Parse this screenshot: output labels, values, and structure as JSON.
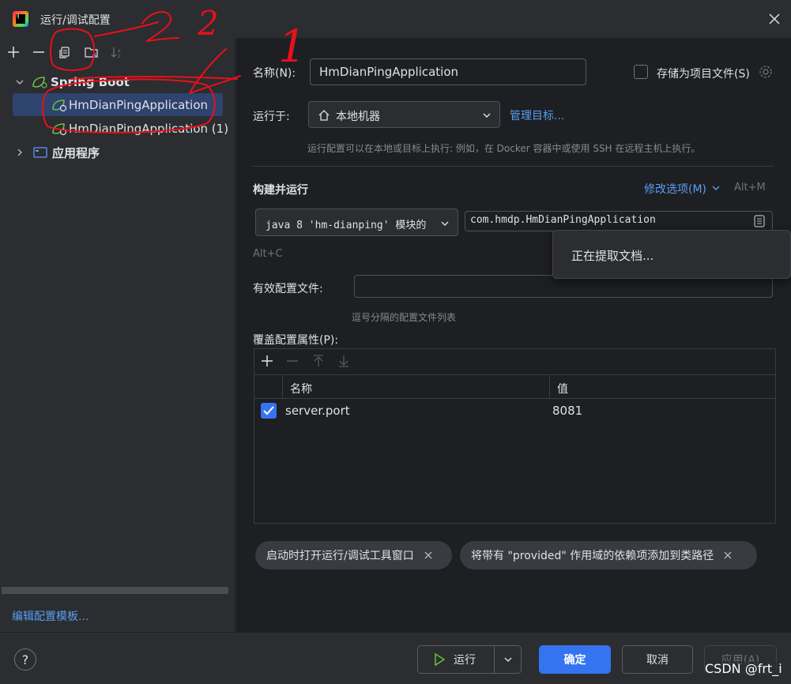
{
  "window": {
    "title": "运行/调试配置",
    "logo_text": "IJ"
  },
  "tree": {
    "group": "Spring Boot",
    "items": [
      {
        "label": "HmDianPingApplication"
      },
      {
        "label": "HmDianPingApplication (1)"
      }
    ],
    "app_group": "应用程序",
    "edit_templates": "编辑配置模板..."
  },
  "form": {
    "name_label": "名称(N):",
    "name_value": "HmDianPingApplication",
    "store_label": "存储为项目文件(S)",
    "run_on_label": "运行于:",
    "run_on_value": "本地机器",
    "manage_targets": "管理目标...",
    "run_on_hint": "运行配置可以在本地或目标上执行: 例如，在 Docker 容器中或使用 SSH 在远程主机上执行。",
    "build_run": "构建并运行",
    "modify_options": "修改选项(M)",
    "modify_shortcut": "Alt+M",
    "jdk_value": "java 8 'hm-dianping' 模块的",
    "main_class": "com.hmdp.HmDianPingApplication",
    "jdk_shortcut": "Alt+C",
    "profiles_label": "有效配置文件:",
    "profiles_value": "",
    "profiles_hint": "逗号分隔的配置文件列表",
    "override_label": "覆盖配置属性(P):",
    "table": {
      "col_name": "名称",
      "col_value": "值",
      "rows": [
        {
          "name": "server.port",
          "value": "8081",
          "checked": true
        }
      ]
    },
    "chips": [
      {
        "label": "启动时打开运行/调试工具窗口"
      },
      {
        "label": "将带有 \"provided\" 作用域的依赖项添加到类路径"
      }
    ]
  },
  "popup": {
    "text": "正在提取文档..."
  },
  "buttons": {
    "help": "?",
    "run": "运行",
    "ok": "确定",
    "cancel": "取消",
    "apply": "应用(A)"
  },
  "watermark": "CSDN @frt_i",
  "annotations": {
    "mark_1": "1",
    "mark_2": "2"
  },
  "colors": {
    "accent": "#3574f0",
    "link": "#589df6",
    "selection": "#2e436e",
    "annotation": "#e8101a",
    "spring_icon": "#6cbf43"
  }
}
